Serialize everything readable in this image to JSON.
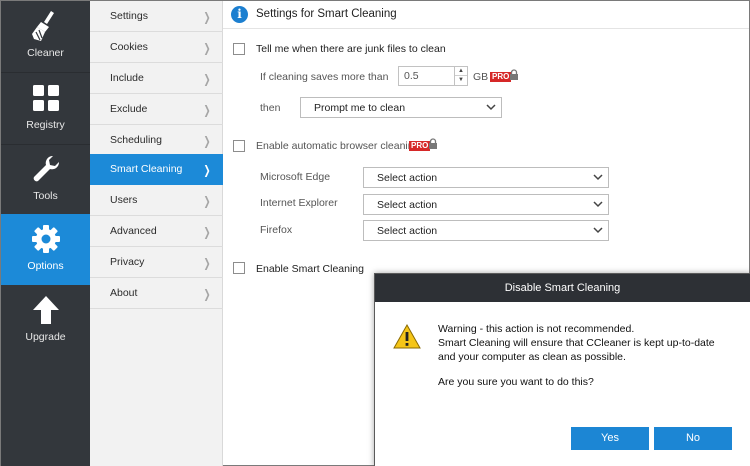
{
  "nav": {
    "items": [
      {
        "label": "Cleaner",
        "icon": "broom-icon"
      },
      {
        "label": "Registry",
        "icon": "grid-icon"
      },
      {
        "label": "Tools",
        "icon": "wrench-icon"
      },
      {
        "label": "Options",
        "icon": "gear-icon"
      },
      {
        "label": "Upgrade",
        "icon": "upgrade-arrow-icon"
      }
    ],
    "active": "Options",
    "active_color": "#1c8ad8",
    "background_color": "#33373c"
  },
  "settings_menu": {
    "items": [
      "Settings",
      "Cookies",
      "Include",
      "Exclude",
      "Scheduling",
      "Smart Cleaning",
      "Users",
      "Advanced",
      "Privacy",
      "About"
    ],
    "active": "Smart Cleaning"
  },
  "header": {
    "title": "Settings for Smart Cleaning",
    "icon": "info-icon"
  },
  "junk_files": {
    "label": "Tell me when there are junk files to clean",
    "checked": false,
    "threshold_label": "If cleaning saves more than",
    "threshold_value": "0.5",
    "unit": "GB",
    "pro_badge": "PRO",
    "then_label": "then",
    "then_option": "Prompt me to clean"
  },
  "browser_cleaning": {
    "label": "Enable automatic browser cleaning",
    "checked": false,
    "pro_badge": "PRO",
    "browsers": [
      {
        "name": "Microsoft Edge",
        "action": "Select action"
      },
      {
        "name": "Internet Explorer",
        "action": "Select action"
      },
      {
        "name": "Firefox",
        "action": "Select action"
      }
    ]
  },
  "smart_cleaning": {
    "label": "Enable Smart Cleaning",
    "checked": false
  },
  "dialog": {
    "title": "Disable Smart Cleaning",
    "icon": "warning-icon",
    "line1": "Warning - this action is not recommended.",
    "line2": "Smart Cleaning will ensure that CCleaner is kept up-to-date",
    "line3": "and your computer as clean as possible.",
    "question": "Are you sure you want to do this?",
    "yes_label": "Yes",
    "no_label": "No",
    "button_color": "#1c86d4"
  }
}
